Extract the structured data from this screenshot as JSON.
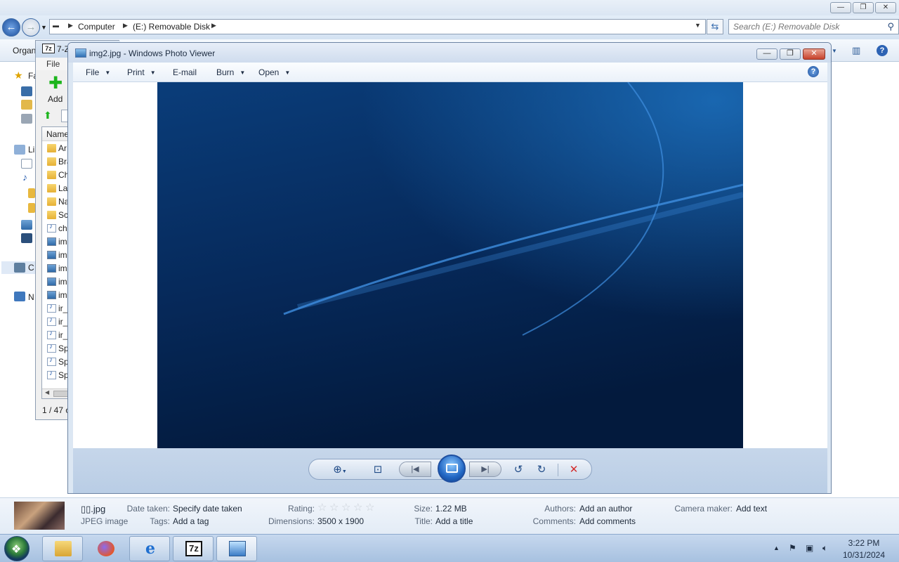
{
  "explorer": {
    "address": {
      "segments": [
        "Computer",
        "(E:) Removable Disk"
      ]
    },
    "search": {
      "placeholder": "Search (E:) Removable Disk"
    },
    "toolbar": {
      "organize_label": "Organ"
    },
    "nav_pane": {
      "items": [
        "Fa",
        "Li",
        "C",
        "N"
      ]
    },
    "details_pane": {
      "file_name": "▯▯.jpg",
      "file_type": "JPEG image",
      "fields": [
        {
          "key": "Date taken:",
          "value": "Specify date taken"
        },
        {
          "key": "Tags:",
          "value": "Add a tag"
        },
        {
          "key": "Rating:",
          "value": ""
        },
        {
          "key": "Dimensions:",
          "value": "3500 x 1900"
        },
        {
          "key": "Size:",
          "value": "1.22 MB"
        },
        {
          "key": "Title:",
          "value": "Add a title"
        },
        {
          "key": "Authors:",
          "value": "Add an author"
        },
        {
          "key": "Comments:",
          "value": "Add comments"
        },
        {
          "key": "Camera maker:",
          "value": "Add text"
        }
      ],
      "rating_stars": 0
    }
  },
  "sevenzip": {
    "title": "7-Z",
    "menu": [
      "File"
    ],
    "add_label": "Add",
    "list_header": "Name",
    "rows": [
      {
        "name": "Ar",
        "icon": "folder"
      },
      {
        "name": "Bra",
        "icon": "folder"
      },
      {
        "name": "Ch",
        "icon": "folder"
      },
      {
        "name": "Lar",
        "icon": "folder"
      },
      {
        "name": "Na",
        "icon": "folder"
      },
      {
        "name": "Sc",
        "icon": "folder"
      },
      {
        "name": "ch",
        "icon": "audio"
      },
      {
        "name": "im",
        "icon": "image"
      },
      {
        "name": "im",
        "icon": "image"
      },
      {
        "name": "im",
        "icon": "image"
      },
      {
        "name": "im",
        "icon": "image"
      },
      {
        "name": "im",
        "icon": "image"
      },
      {
        "name": "ir_",
        "icon": "audio"
      },
      {
        "name": "ir_",
        "icon": "audio"
      },
      {
        "name": "ir_",
        "icon": "audio"
      },
      {
        "name": "Sp",
        "icon": "audio"
      },
      {
        "name": "Sp",
        "icon": "audio"
      },
      {
        "name": "Sp",
        "icon": "audio"
      }
    ],
    "status": "1 / 47 o"
  },
  "photo_viewer": {
    "title": "img2.jpg - Windows Photo Viewer",
    "menu": [
      {
        "label": "File",
        "dropdown": true
      },
      {
        "label": "Print",
        "dropdown": true
      },
      {
        "label": "E-mail",
        "dropdown": false
      },
      {
        "label": "Burn",
        "dropdown": true
      },
      {
        "label": "Open",
        "dropdown": true
      }
    ],
    "colors": {
      "image_top": "#0a3d7a",
      "image_bottom": "#031a3d",
      "streak": "#3f8fe0"
    }
  },
  "taskbar": {
    "apps": [
      "windows-explorer",
      "firefox",
      "internet-explorer",
      "7-zip",
      "photo-viewer"
    ],
    "clock_time": "3:22 PM",
    "clock_date": "10/31/2024"
  }
}
